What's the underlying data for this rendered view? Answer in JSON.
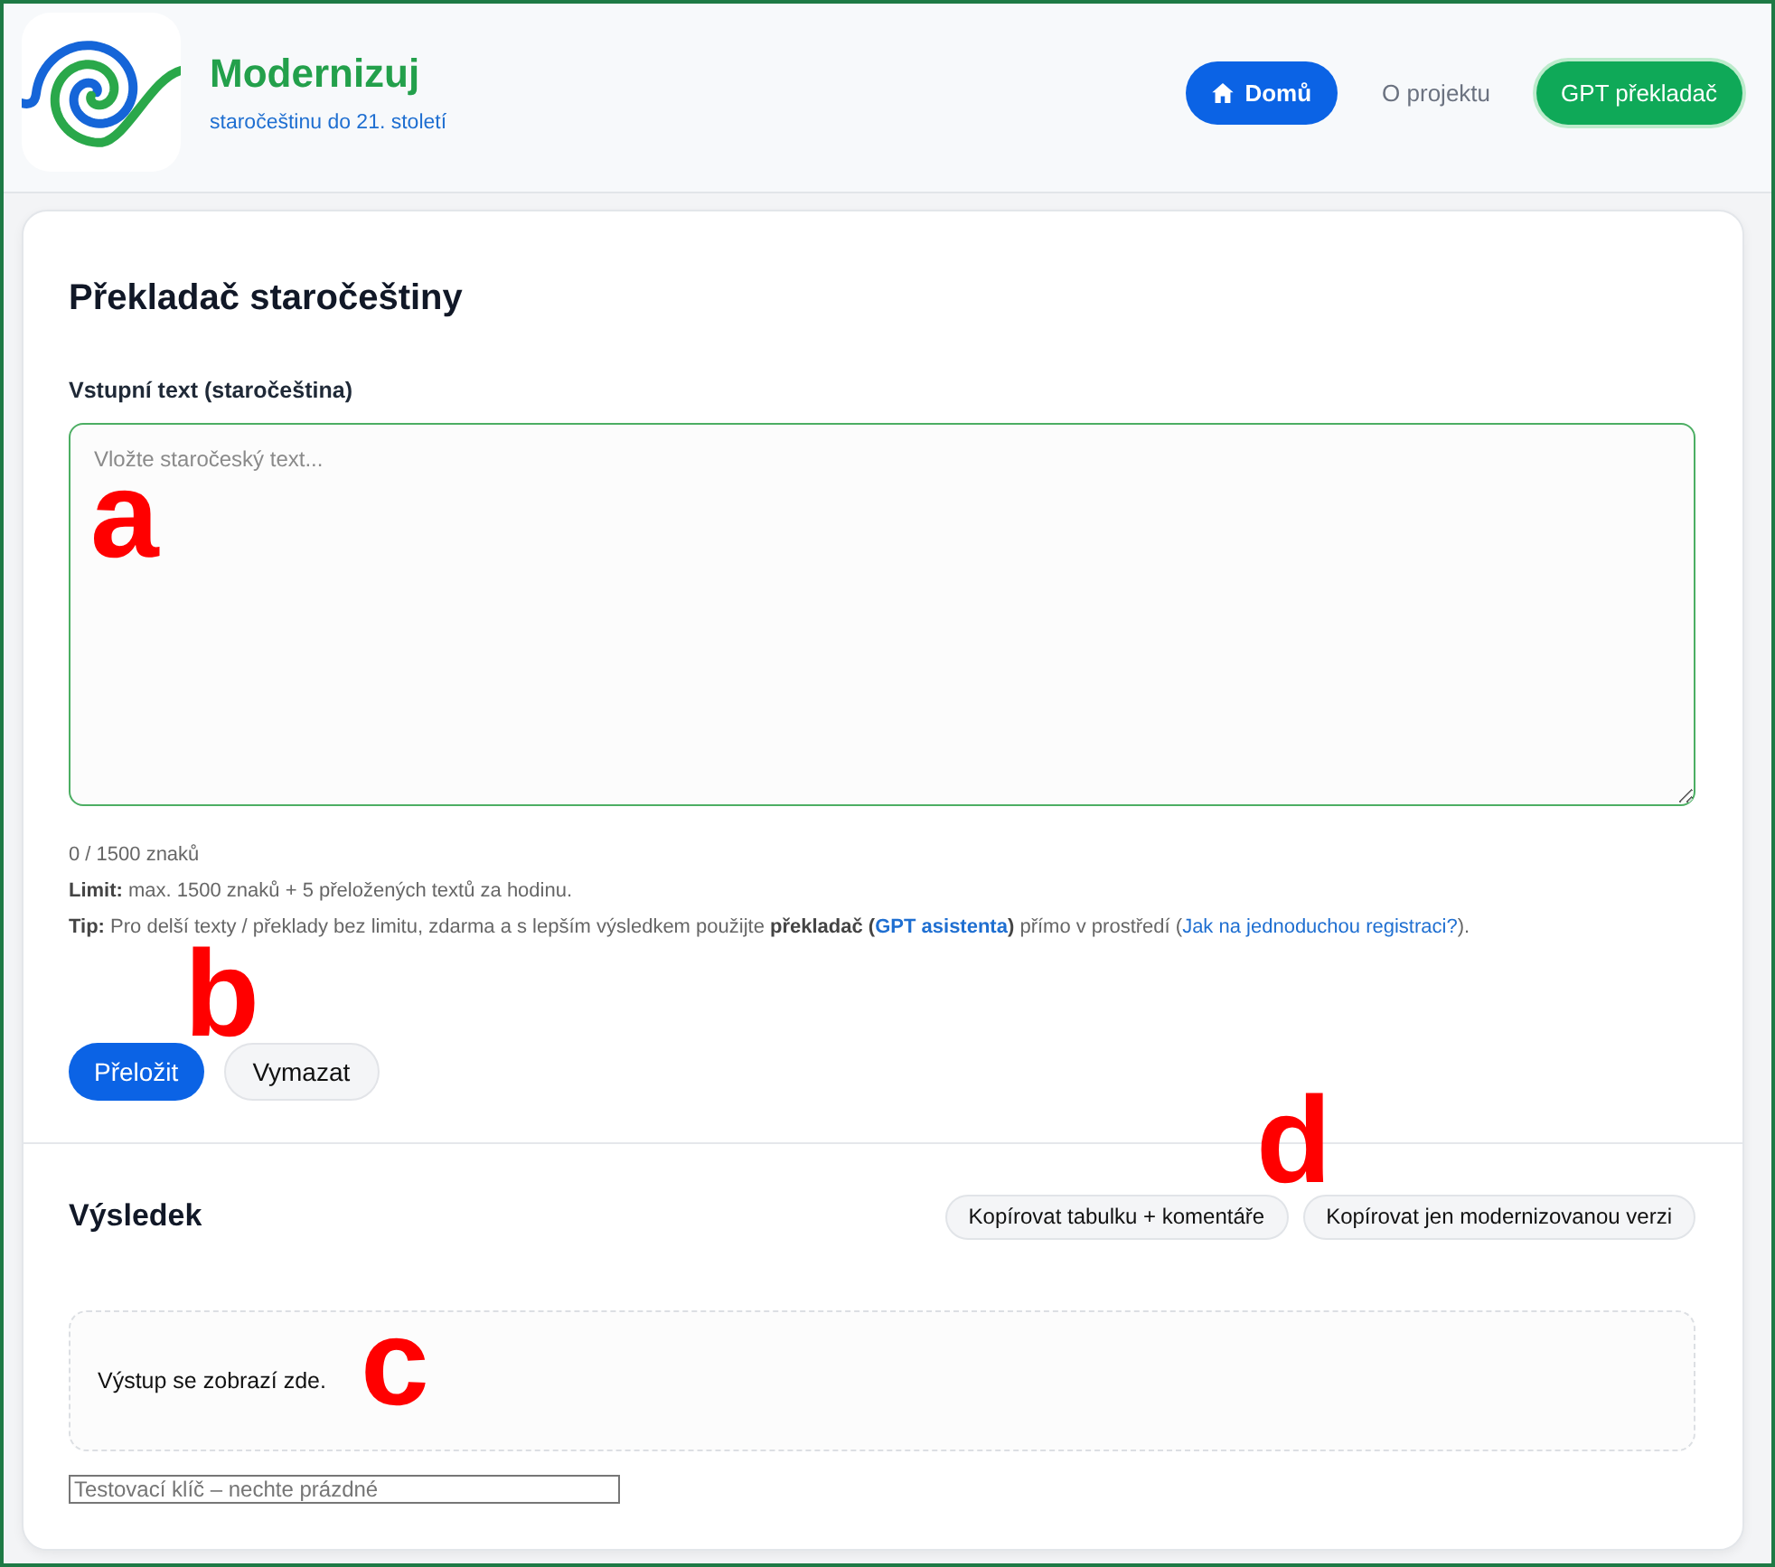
{
  "header": {
    "title": "Modernizuj",
    "subtitle": "staročeštinu do 21. století",
    "nav": [
      {
        "label": "Domů",
        "kind": "home",
        "selected": true
      },
      {
        "label": "O projektu",
        "kind": "link",
        "selected": false
      },
      {
        "label": "GPT překladač",
        "kind": "cta",
        "selected": false
      }
    ]
  },
  "translator": {
    "title": "Překladač staročeštiny",
    "input": {
      "label": "Vstupní text (staročeština)",
      "placeholder": "Vložte staročeský text...",
      "annotation": "a"
    },
    "counter": "0 / 1500 znaků",
    "limit": "**Limit:** max. 1500 znaků + 5 přeložených textů za hodinu.",
    "tip": [
      {
        "kind": "text",
        "text": "**Tip:** Pro delší texty / překlady bez limitu, zdarma a s lepším výsledkem použijte **překladač (**"
      },
      {
        "kind": "link",
        "text": "GPT asistenta",
        "bold": true
      },
      {
        "kind": "text",
        "text": "**)** přímo v prostředí ("
      },
      {
        "kind": "link",
        "text": "Jak na jednoduchou registraci?",
        "bold": false
      },
      {
        "kind": "text",
        "text": ")."
      }
    ],
    "tip_annotation": "b",
    "buttons": [
      {
        "label": "Přeložit",
        "kind": "primary"
      },
      {
        "label": "Vymazat",
        "kind": "secondary"
      }
    ]
  },
  "result": {
    "title": "Výsledek",
    "annotation": "d",
    "copy_buttons": [
      "Kopírovat tabulku + komentáře",
      "Kopírovat jen modernizovanou verzi"
    ],
    "output": {
      "text": "Výstup se zobrazí zde.",
      "annotation": "c"
    },
    "test_key": {
      "placeholder": "Testovací klíč – nechte prázdné"
    }
  }
}
